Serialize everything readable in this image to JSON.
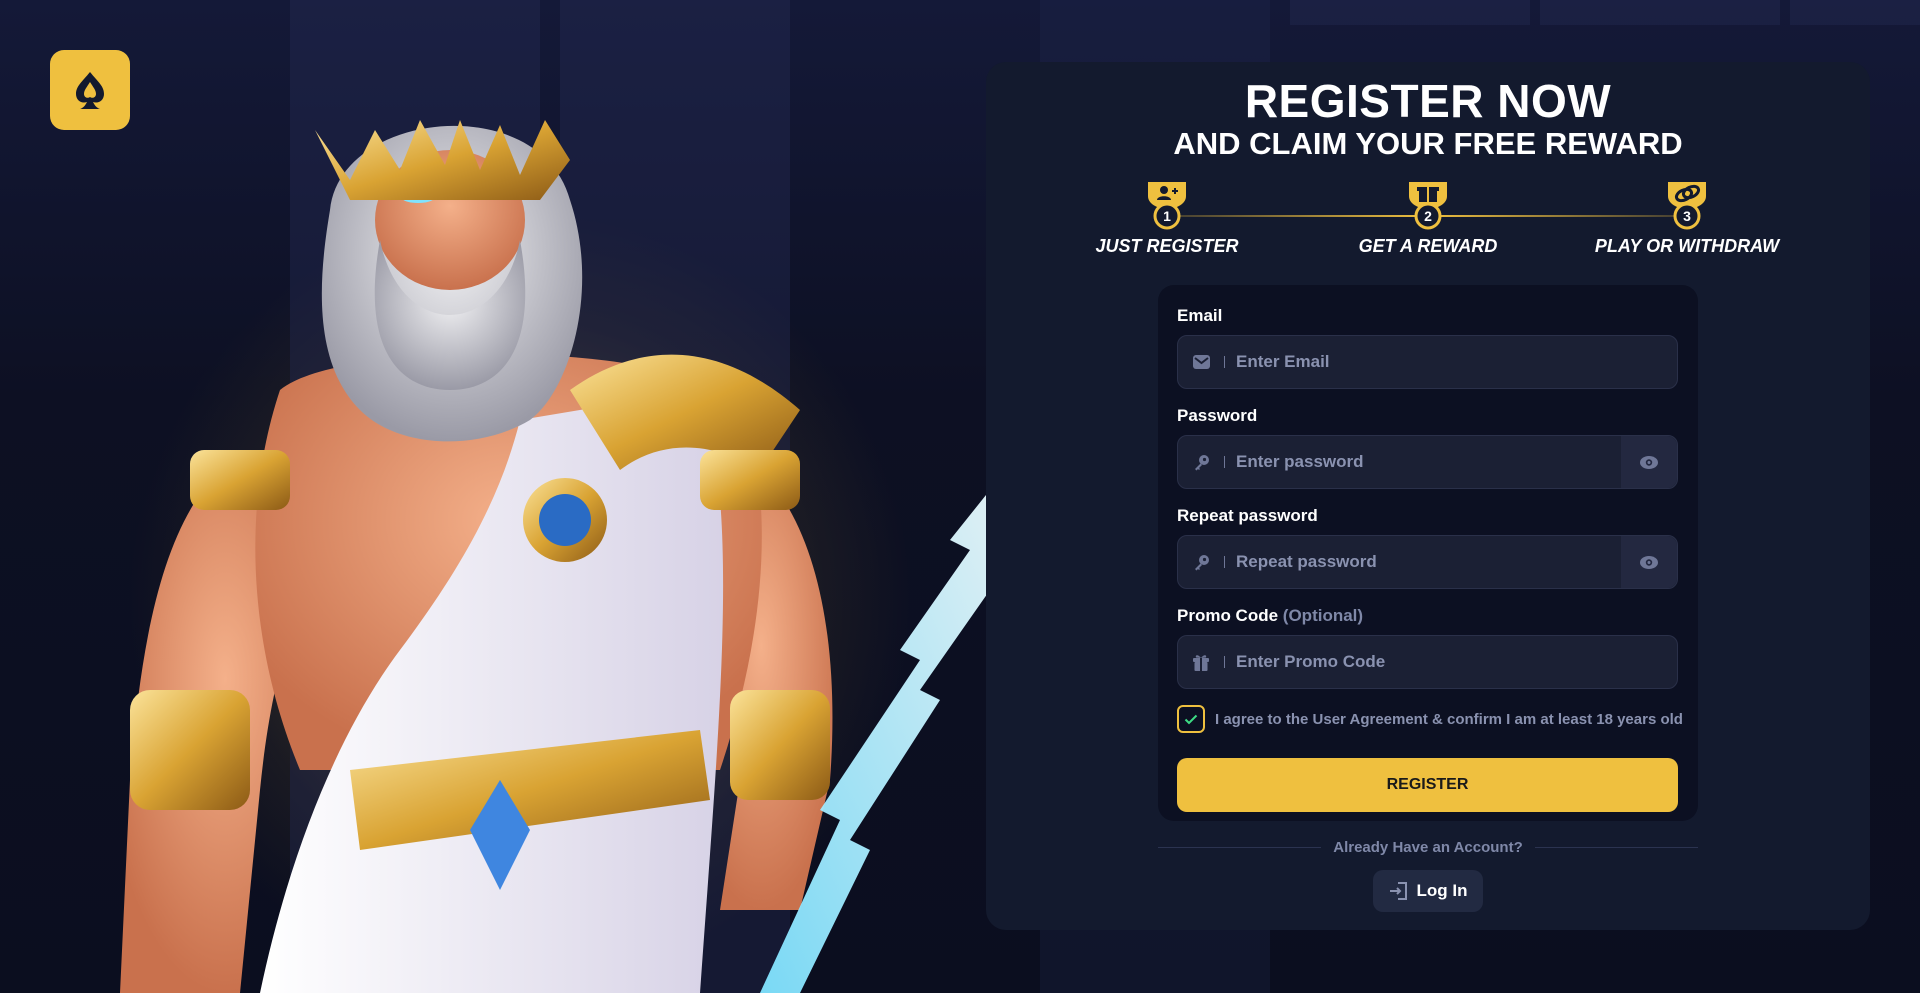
{
  "brand": {
    "accent": "#efc03f",
    "logo_icon": "spade-flame-icon"
  },
  "header": {
    "title": "REGISTER NOW",
    "subtitle": "AND CLAIM YOUR FREE REWARD"
  },
  "steps": [
    {
      "number": "1",
      "label": "JUST REGISTER",
      "icon": "add-user-icon"
    },
    {
      "number": "2",
      "label": "GET A REWARD",
      "icon": "gift-icon"
    },
    {
      "number": "3",
      "label": "PLAY OR WITHDRAW",
      "icon": "coins-icon"
    }
  ],
  "form": {
    "email": {
      "label": "Email",
      "placeholder": "Enter Email",
      "value": ""
    },
    "password": {
      "label": "Password",
      "placeholder": "Enter password",
      "value": ""
    },
    "repeat_password": {
      "label": "Repeat password",
      "placeholder": "Repeat password",
      "value": ""
    },
    "promo": {
      "label": "Promo Code",
      "optional": "(Optional)",
      "placeholder": "Enter Promo Code",
      "value": ""
    },
    "agreement": {
      "text": "I agree to the User Agreement & confirm I am at least 18 years old",
      "checked": true
    },
    "register_label": "REGISTER"
  },
  "footer": {
    "already_text": "Already Have an Account?",
    "login_label": "Log In"
  }
}
